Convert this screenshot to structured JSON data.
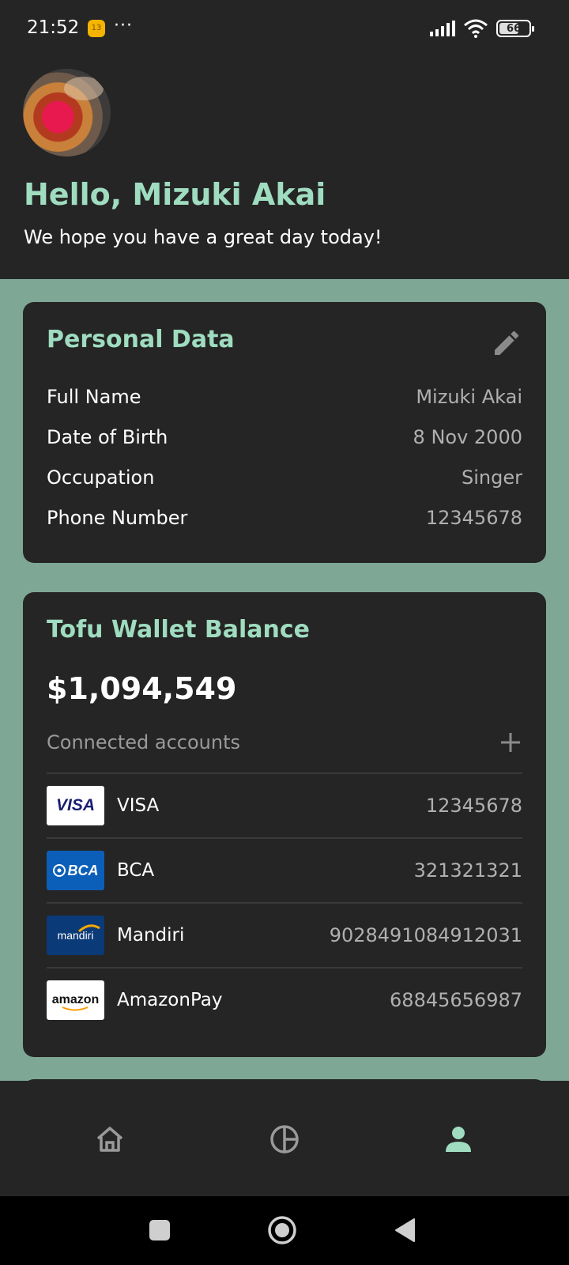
{
  "status_bar": {
    "time": "21:52",
    "notification_badge": "13",
    "more": "···",
    "battery_level": "66",
    "battery_fraction": 0.66
  },
  "profile": {
    "greeting": "Hello, Mizuki Akai",
    "subtitle": "We hope you have a great day today!"
  },
  "personal_data": {
    "title": "Personal Data",
    "fields": [
      {
        "label": "Full Name",
        "value": "Mizuki Akai"
      },
      {
        "label": "Date of Birth",
        "value": "8 Nov 2000"
      },
      {
        "label": "Occupation",
        "value": "Singer"
      },
      {
        "label": "Phone Number",
        "value": "12345678"
      }
    ]
  },
  "wallet": {
    "title": "Tofu Wallet Balance",
    "balance": "$1,094,549",
    "connected_label": "Connected accounts",
    "accounts": [
      {
        "name": "VISA",
        "number": "12345678",
        "logo_text": "VISA"
      },
      {
        "name": "BCA",
        "number": "321321321",
        "logo_text": "BCA"
      },
      {
        "name": "Mandiri",
        "number": "9028491084912031",
        "logo_text": "mandiri"
      },
      {
        "name": "AmazonPay",
        "number": "68845656987",
        "logo_text": "amazon"
      }
    ]
  },
  "bottom_nav": {
    "items": [
      {
        "icon": "home-icon",
        "active": false
      },
      {
        "icon": "pie-chart-icon",
        "active": false
      },
      {
        "icon": "profile-icon",
        "active": true
      }
    ]
  },
  "colors": {
    "accent": "#9fdcc0",
    "content_background": "#7ea895",
    "card_background": "#252525",
    "inactive_icon": "#9a9a9a"
  }
}
